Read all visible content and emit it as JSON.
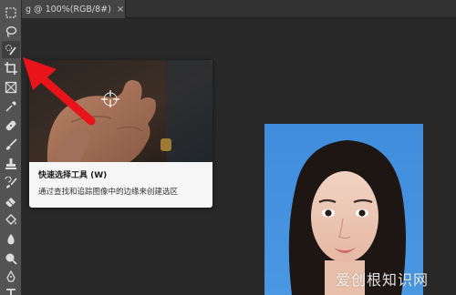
{
  "document": {
    "tab_title": "g @ 100%(RGB/8#)",
    "close_glyph": "×"
  },
  "toolbar": {
    "tools": [
      {
        "name": "rectangular-marquee-tool-icon"
      },
      {
        "name": "lasso-tool-icon"
      },
      {
        "name": "quick-selection-tool-icon",
        "active": true
      },
      {
        "name": "crop-tool-icon"
      },
      {
        "name": "frame-tool-icon"
      },
      {
        "name": "eyedropper-tool-icon"
      },
      {
        "name": "healing-brush-tool-icon"
      },
      {
        "name": "brush-tool-icon"
      },
      {
        "name": "clone-stamp-tool-icon"
      },
      {
        "name": "history-brush-tool-icon"
      },
      {
        "name": "eraser-tool-icon"
      },
      {
        "name": "paint-bucket-tool-icon"
      },
      {
        "name": "blur-tool-icon"
      },
      {
        "name": "dodge-tool-icon"
      },
      {
        "name": "pen-tool-icon"
      },
      {
        "name": "type-tool-icon"
      }
    ]
  },
  "tooltip": {
    "title": "快速选择工具 (W)",
    "description": "通过查找和追踪图像中的边缘来创建选区"
  },
  "watermark": "爱创根知识网",
  "colors": {
    "app_bg": "#282828",
    "toolbar_bg": "#535353",
    "arrow_red": "#e8141a",
    "photo_bg": "#3f8ddc"
  }
}
